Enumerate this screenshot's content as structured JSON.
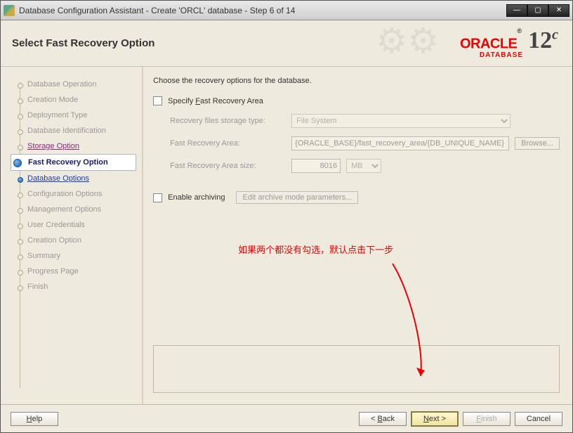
{
  "window": {
    "title": "Database Configuration Assistant - Create 'ORCL' database - Step 6 of 14"
  },
  "header": {
    "page_title": "Select Fast Recovery Option",
    "brand": "ORACLE",
    "product_line": "DATABASE",
    "version": "12",
    "version_suffix": "c"
  },
  "sidebar": {
    "items": [
      {
        "label": "Database Operation"
      },
      {
        "label": "Creation Mode"
      },
      {
        "label": "Deployment Type"
      },
      {
        "label": "Database Identification"
      },
      {
        "label": "Storage Option"
      },
      {
        "label": "Fast Recovery Option"
      },
      {
        "label": "Database Options"
      },
      {
        "label": "Configuration Options"
      },
      {
        "label": "Management Options"
      },
      {
        "label": "User Credentials"
      },
      {
        "label": "Creation Option"
      },
      {
        "label": "Summary"
      },
      {
        "label": "Progress Page"
      },
      {
        "label": "Finish"
      }
    ]
  },
  "main": {
    "instruction": "Choose the recovery options for the database.",
    "specify_fra_label": "Specify Fast Recovery Area",
    "storage_type_label": "Recovery files storage type:",
    "storage_type_value": "File System",
    "fra_label": "Fast Recovery Area:",
    "fra_value": "{ORACLE_BASE}/fast_recovery_area/{DB_UNIQUE_NAME}",
    "browse_label": "Browse...",
    "fra_size_label": "Fast Recovery Area size:",
    "fra_size_value": "8016",
    "fra_size_unit": "MB",
    "enable_archiving_label": "Enable archiving",
    "edit_archive_label": "Edit archive mode parameters...",
    "annotation_text": "如果两个都没有勾选，默认点击下一步"
  },
  "footer": {
    "help": "Help",
    "back": "< Back",
    "next": "Next >",
    "finish": "Finish",
    "cancel": "Cancel"
  }
}
